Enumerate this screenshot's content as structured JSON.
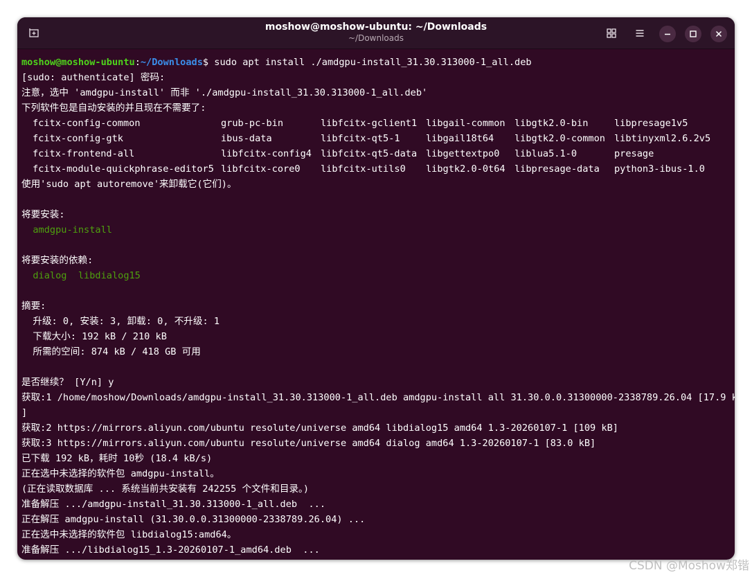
{
  "window": {
    "title": "moshow@moshow-ubuntu: ~/Downloads",
    "subtitle": "~/Downloads"
  },
  "prompt": {
    "user_host": "moshow@moshow-ubuntu",
    "colon": ":",
    "path": "~/Downloads",
    "symbol": "$",
    "command": " sudo apt install ./amdgpu-install_31.30.313000-1_all.deb"
  },
  "lines": {
    "sudo": "[sudo: authenticate] 密码:",
    "note": "注意，选中 'amdgpu-install' 而非 './amdgpu-install_31.30.313000-1_all.deb'",
    "auto_installed": "下列软件包是自动安装的并且现在不需要了:",
    "autoremove": "使用'sudo apt autoremove'来卸载它(它们)。",
    "will_install": "将要安装:",
    "install_pkg": "  amdgpu-install",
    "will_install_deps": "将要安装的依赖:",
    "deps_pkgs": "  dialog  libdialog15",
    "summary": "摘要:",
    "summary_upgrade": "  升级: 0, 安装: 3, 卸载: 0, 不升级: 1",
    "summary_download": "  下载大小: 192 kB / 210 kB",
    "summary_space": "  所需的空间: 874 kB / 418 GB 可用",
    "continue": "是否继续？ [Y/n] y",
    "get1": "获取:1 /home/moshow/Downloads/amdgpu-install_31.30.313000-1_all.deb amdgpu-install all 31.30.0.0.31300000-2338789.26.04 [17.9 kB",
    "get1_cont": "]",
    "get2": "获取:2 https://mirrors.aliyun.com/ubuntu resolute/universe amd64 libdialog15 amd64 1.3-20260107-1 [109 kB]",
    "get3": "获取:3 https://mirrors.aliyun.com/ubuntu resolute/universe amd64 dialog amd64 1.3-20260107-1 [83.0 kB]",
    "downloaded": "已下载 192 kB，耗时 10秒 (18.4 kB/s)",
    "selecting1": "正在选中未选择的软件包 amdgpu-install。",
    "reading_db": "(正在读取数据库 ... 系统当前共安装有 242255 个文件和目录。)",
    "prep_unpack1": "准备解压 .../amdgpu-install_31.30.313000-1_all.deb  ...",
    "unpacking1": "正在解压 amdgpu-install (31.30.0.0.31300000-2338789.26.04) ...",
    "selecting2": "正在选中未选择的软件包 libdialog15:amd64。",
    "prep_unpack2": "准备解压 .../libdialog15_1.3-20260107-1_amd64.deb  ..."
  },
  "autoremove_packages": [
    [
      "fcitx-config-common",
      "grub-pc-bin",
      "libfcitx-gclient1",
      "libgail-common",
      "libgtk2.0-bin",
      "libpresage1v5"
    ],
    [
      "fcitx-config-gtk",
      "ibus-data",
      "libfcitx-qt5-1",
      "libgail18t64",
      "libgtk2.0-common",
      "libtinyxml2.6.2v5"
    ],
    [
      "fcitx-frontend-all",
      "libfcitx-config4",
      "libfcitx-qt5-data",
      "libgettextpo0",
      "liblua5.1-0",
      "presage"
    ],
    [
      "fcitx-module-quickphrase-editor5",
      "libfcitx-core0",
      "libfcitx-utils0",
      "libgtk2.0-0t64",
      "libpresage-data",
      "python3-ibus-1.0"
    ]
  ],
  "watermark": "CSDN @Moshow郑锴",
  "colors": {
    "background": "#300a24",
    "titlebar": "#2c1427",
    "prompt_user": "#4ed31b",
    "prompt_path": "#3b8eea",
    "green_text": "#4ea00e"
  }
}
